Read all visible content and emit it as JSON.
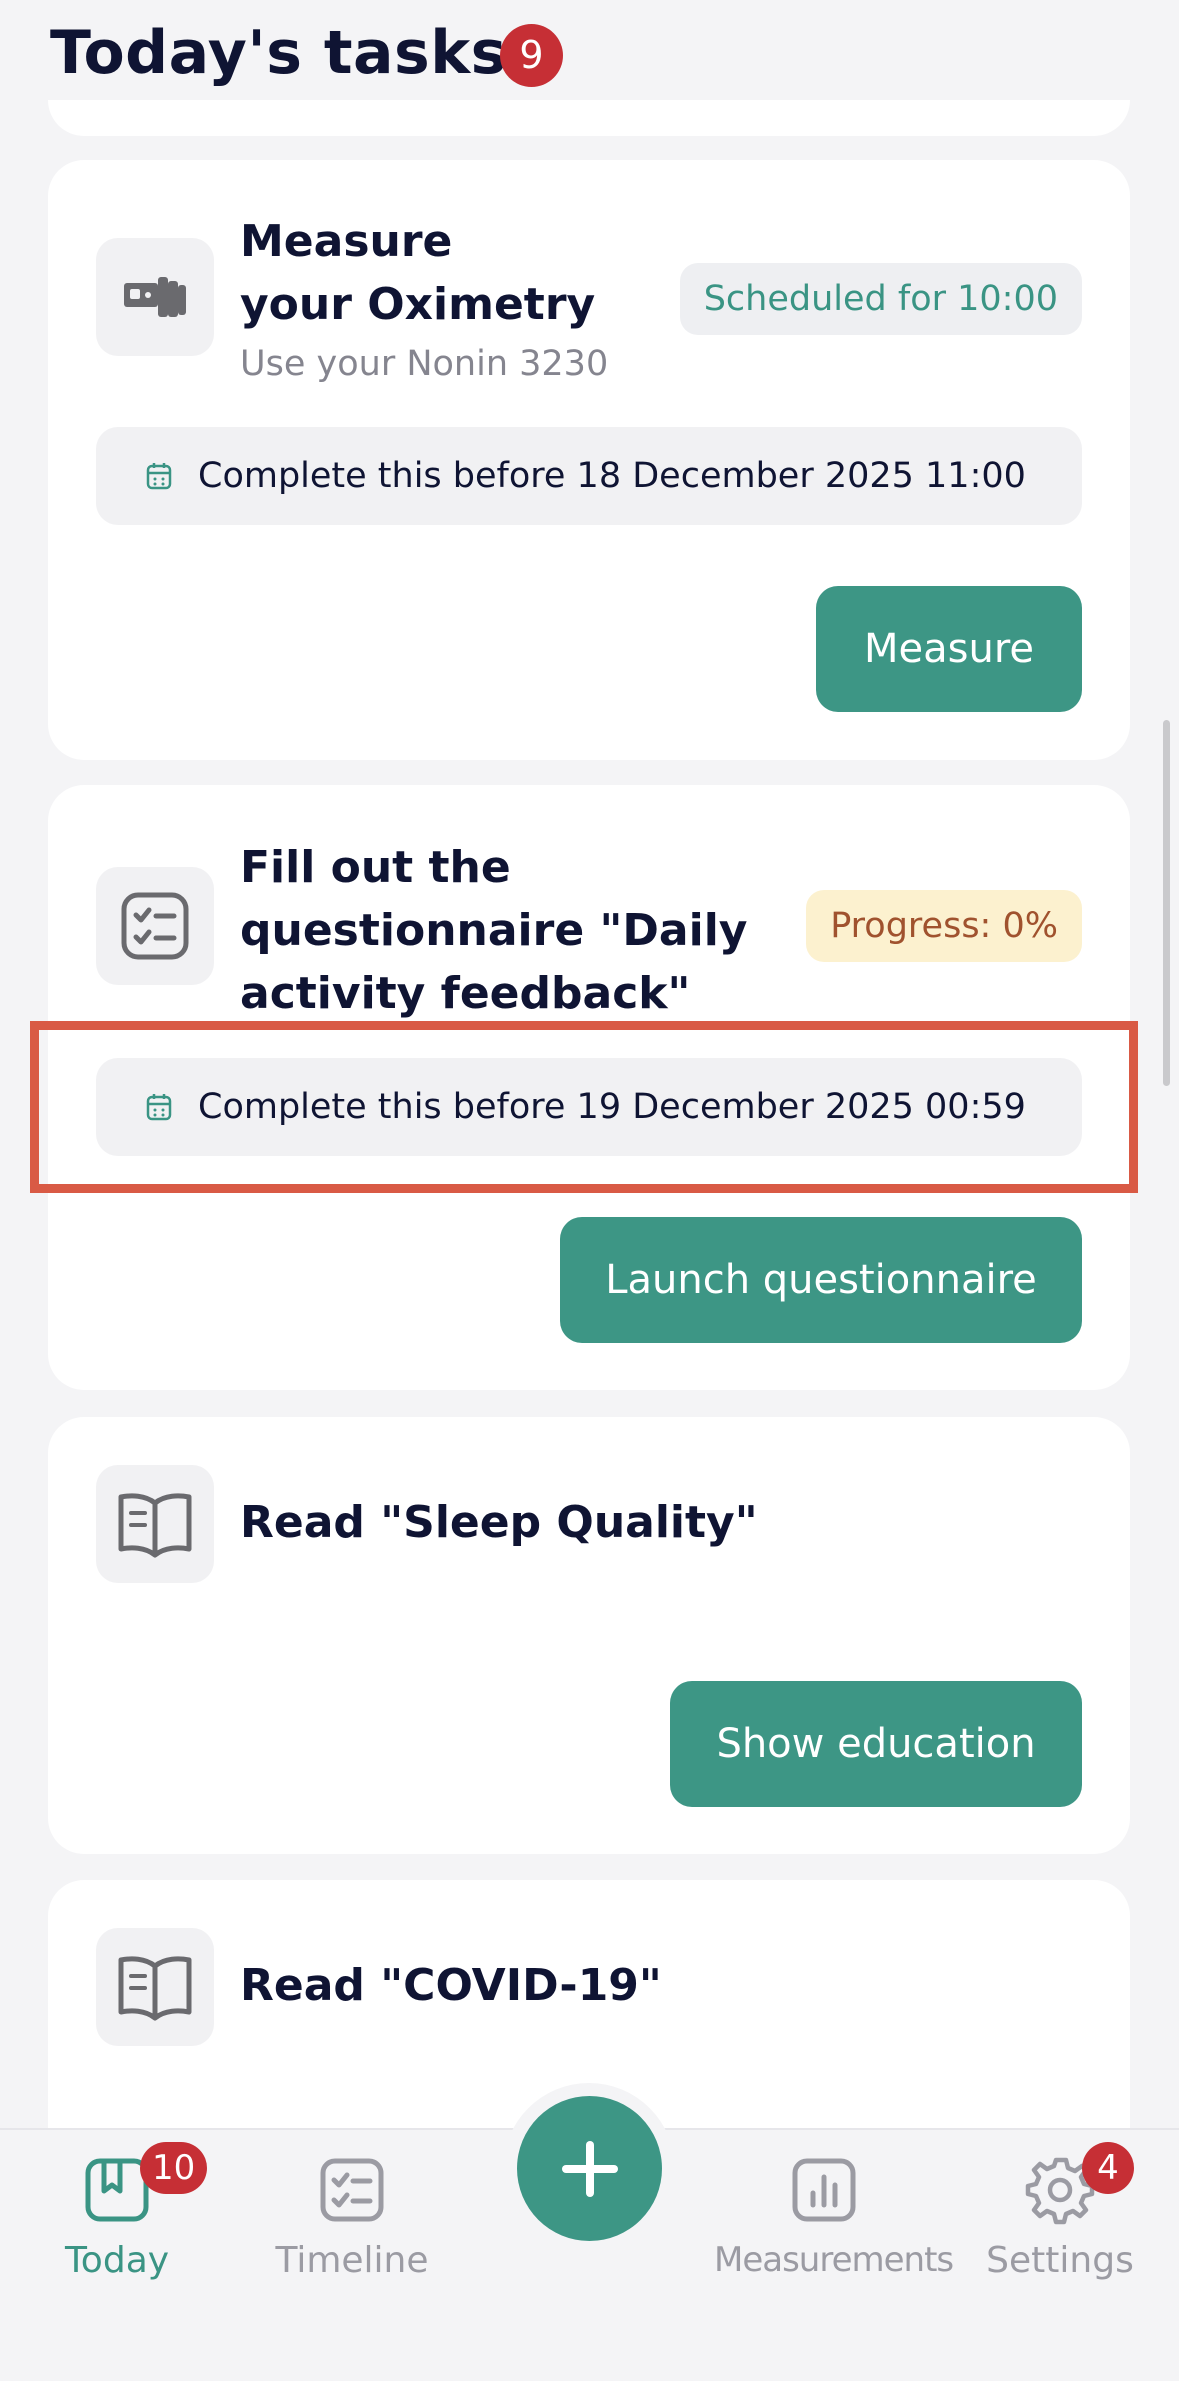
{
  "header": {
    "title": "Today's tasks",
    "task_count": "9"
  },
  "tasks": [
    {
      "title_line1": "Measure",
      "title_line2": "your Oximetry",
      "subtitle": "Use your Nonin 3230",
      "status": "Scheduled for 10:00",
      "icon": "oximeter-icon",
      "deadline": "Complete this before 18 December 2025 11:00",
      "button": "Measure"
    },
    {
      "title_line1": "Fill out the",
      "title_line2": "questionnaire \"Daily",
      "title_line3": "activity feedback\"",
      "status": "Progress: 0%",
      "progress_percent": 0,
      "icon": "checklist-icon",
      "deadline": "Complete this before 19 December 2025 00:59",
      "button": "Launch questionnaire"
    },
    {
      "title": "Read \"Sleep Quality\"",
      "icon": "book-icon",
      "button": "Show education"
    },
    {
      "title": "Read \"COVID-19\"",
      "icon": "book-icon"
    }
  ],
  "nav": {
    "today": {
      "label": "Today",
      "badge": "10",
      "icon": "bookmark-icon"
    },
    "timeline": {
      "label": "Timeline",
      "icon": "checklist-icon"
    },
    "add": {
      "icon": "plus-icon"
    },
    "measurements": {
      "label": "Measurements",
      "icon": "bar-chart-icon"
    },
    "settings": {
      "label": "Settings",
      "badge": "4",
      "icon": "gear-icon"
    }
  },
  "colors": {
    "accent": "#3d9685",
    "badge": "#c62f35",
    "highlight": "#d95a45",
    "progress_pill": "#fcf1cf"
  }
}
